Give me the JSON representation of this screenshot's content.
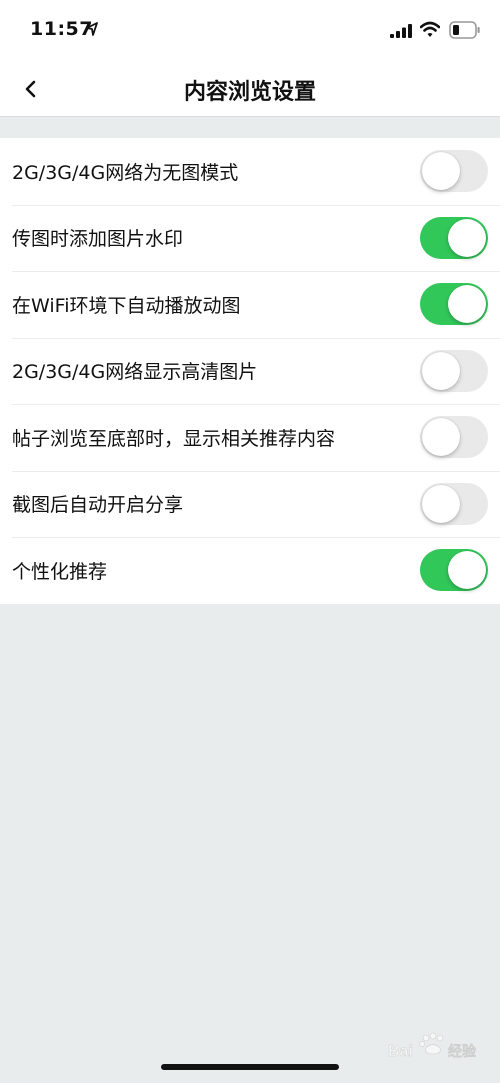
{
  "status_bar": {
    "time": "11:57"
  },
  "nav": {
    "title": "内容浏览设置",
    "back_icon": "chevron-left-icon"
  },
  "settings": [
    {
      "label": "2G/3G/4G网络为无图模式",
      "enabled": false
    },
    {
      "label": "传图时添加图片水印",
      "enabled": true
    },
    {
      "label": "在WiFi环境下自动播放动图",
      "enabled": true
    },
    {
      "label": "2G/3G/4G网络显示高清图片",
      "enabled": false
    },
    {
      "label": "帖子浏览至底部时，显示相关推荐内容",
      "enabled": false
    },
    {
      "label": "截图后自动开启分享",
      "enabled": false
    },
    {
      "label": "个性化推荐",
      "enabled": true
    }
  ],
  "colors": {
    "toggle_on": "#32c759",
    "toggle_off": "#e9e9ea",
    "background": "#e9ecec"
  }
}
